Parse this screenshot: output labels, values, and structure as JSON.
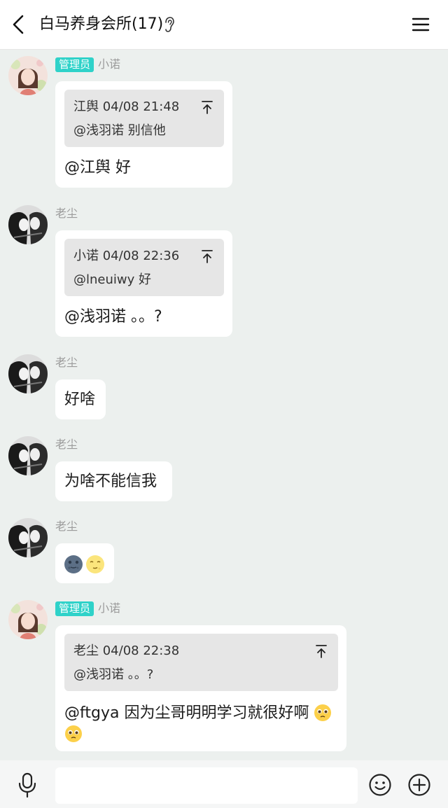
{
  "header": {
    "title": "白马养身会所(17)",
    "icons": [
      "back-arrow-icon",
      "ear-icon",
      "menu-icon"
    ]
  },
  "messages": [
    {
      "badge": "管理员",
      "sender": "小诺",
      "quote": {
        "head": "江舆 04/08 21:48",
        "body": "@浅羽诺 别信他"
      },
      "text": "@江舆 好"
    },
    {
      "sender": "老尘",
      "quote": {
        "head": "小诺 04/08 22:36",
        "body": "@lneuiwy 好"
      },
      "text": "@浅羽诺 。。?"
    },
    {
      "sender": "老尘",
      "text": "好啥"
    },
    {
      "sender": "老尘",
      "text": "为啥不能信我"
    },
    {
      "sender": "老尘",
      "emoji": [
        "new-moon-face-emoji",
        "full-moon-face-emoji"
      ]
    },
    {
      "badge": "管理员",
      "sender": "小诺",
      "quote": {
        "head": "老尘 04/08 22:38",
        "body": "@浅羽诺 。。?"
      },
      "text_line1": "@ftgya 因为尘哥明明学习就很好啊",
      "emoji": [
        "pleading-face-emoji",
        "pleading-face-emoji"
      ]
    }
  ],
  "colors": {
    "background": "#ecf0ee",
    "admin_badge": "#2fd2c9",
    "bubble": "#ffffff",
    "quote": "#e6e6e6"
  },
  "bottom_bar": {
    "input_value": "",
    "icons": [
      "microphone-icon",
      "emoji-icon",
      "plus-icon"
    ]
  }
}
